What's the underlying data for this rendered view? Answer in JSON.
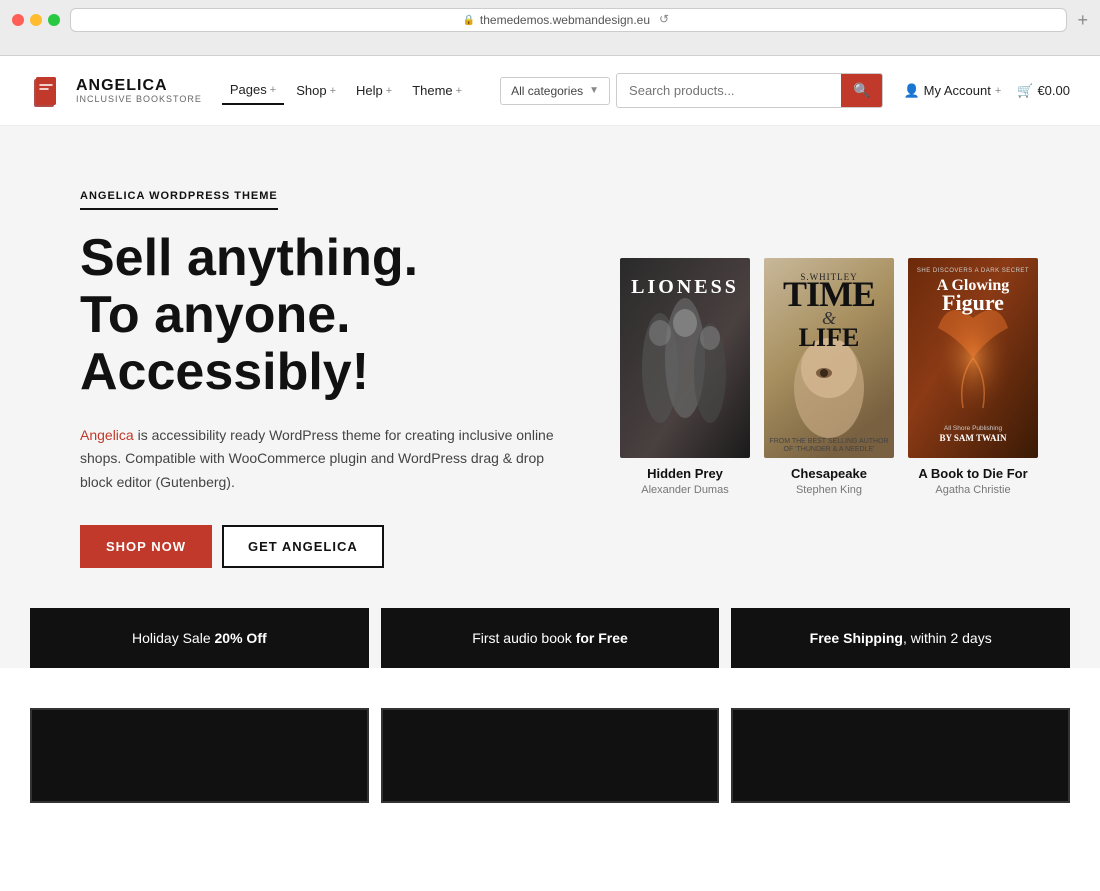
{
  "browser": {
    "url": "themedemos.webmandesign.eu",
    "new_tab_label": "+"
  },
  "nav": {
    "logo_name": "ANGELICA",
    "logo_sub": "INCLUSIVE BOOKSTORE",
    "links": [
      {
        "label": "Pages",
        "active": true
      },
      {
        "label": "Shop"
      },
      {
        "label": "Help"
      },
      {
        "label": "Theme"
      }
    ],
    "search_placeholder": "Search products...",
    "category_default": "All categories",
    "account_label": "My Account",
    "cart_label": "€0.00"
  },
  "hero": {
    "eyebrow": "ANGELICA WORDPRESS THEME",
    "headline_line1": "Sell anything.",
    "headline_line2": "To anyone.",
    "headline_line3": "Accessibly!",
    "desc_link": "Angelica",
    "desc_text": " is accessibility ready WordPress theme for creating inclusive online shops. Compatible with WooCommerce plugin and WordPress drag & drop block editor (Gutenberg).",
    "btn_primary": "SHOP NOW",
    "btn_secondary": "GET ANGELICA"
  },
  "books": [
    {
      "cover_label": "LIONESS",
      "title": "Hidden Prey",
      "author": "Alexander Dumas"
    },
    {
      "cover_label": "TIME & LIFE",
      "title": "Chesapeake",
      "author": "Stephen King"
    },
    {
      "cover_label": "A Glowing Figure",
      "title": "A Book to Die For",
      "author": "Agatha Christie"
    }
  ],
  "promo": [
    {
      "text_normal": "Holiday Sale ",
      "text_bold": "20% Off"
    },
    {
      "text_normal": "First audio book ",
      "text_bold": "for Free"
    },
    {
      "text_normal": "Free Shipping",
      "text_bold": ", within 2 days"
    }
  ],
  "icons": {
    "search": "🔍",
    "account": "👤",
    "cart": "🛒",
    "lock": "🔒"
  }
}
